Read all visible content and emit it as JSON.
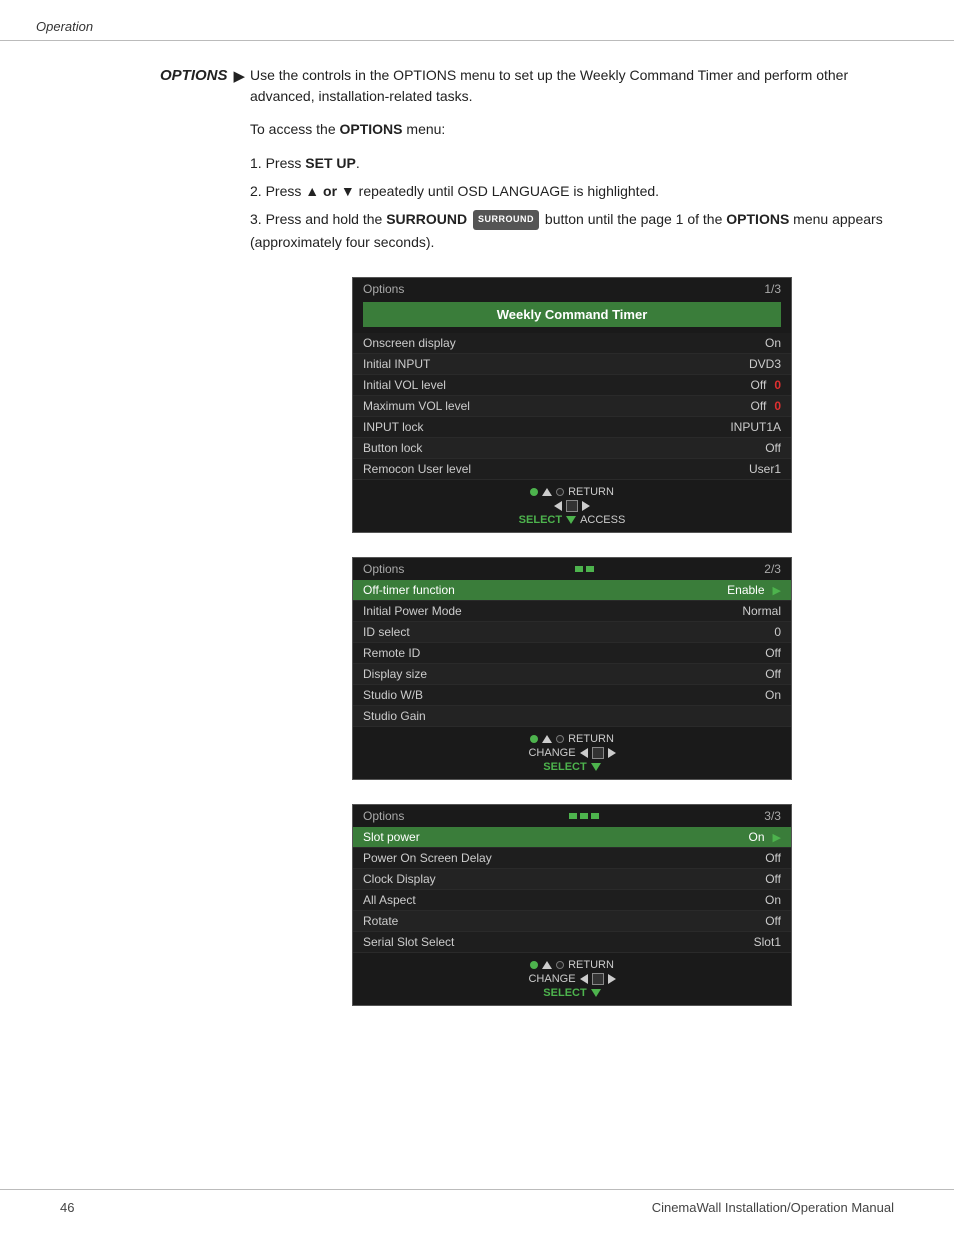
{
  "header": {
    "breadcrumb": "Operation"
  },
  "section": {
    "label": "OPTIONS",
    "arrow": "▶",
    "description": "Use the controls in the OPTIONS menu to set up the Weekly Command Timer and perform other advanced, installation-related tasks.",
    "access_intro": "To access the",
    "access_bold": "OPTIONS",
    "access_suffix": "menu:",
    "steps": [
      {
        "num": "1.",
        "text": "Press ",
        "bold": "SET UP",
        "rest": "."
      },
      {
        "num": "2.",
        "text": "Press ",
        "symbol": "▲ or ▼",
        "rest": " repeatedly until OSD LANGUAGE is highlighted."
      },
      {
        "num": "3.",
        "text": "Press and hold the ",
        "bold": "SURROUND",
        "badge": "SURROUND",
        "mid": " button until the page 1 of the ",
        "bold2": "OPTIONS",
        "end": " menu appears (approximately four seconds)."
      }
    ]
  },
  "panel1": {
    "title_label": "Options",
    "page": "1/3",
    "highlight_row": "Weekly Command Timer",
    "rows": [
      {
        "label": "Onscreen display",
        "value": "On",
        "red": ""
      },
      {
        "label": "Initial INPUT",
        "value": "DVD3",
        "red": ""
      },
      {
        "label": "Initial VOL level",
        "value": "Off",
        "red": "0"
      },
      {
        "label": "Maximum VOL level",
        "value": "Off",
        "red": "0"
      },
      {
        "label": "INPUT lock",
        "value": "INPUT1A",
        "red": ""
      },
      {
        "label": "Button lock",
        "value": "Off",
        "red": ""
      },
      {
        "label": "Remocon User level",
        "value": "User1",
        "red": ""
      }
    ],
    "nav": {
      "line1": {
        "dot1": "green",
        "triangle": "up",
        "dot2": "black",
        "label": "RETURN"
      },
      "line2": {
        "left": true,
        "square": true,
        "right": true
      },
      "line3": {
        "label_green": "SELECT",
        "triangle_down": true,
        "label_white": "ACCESS"
      }
    }
  },
  "panel2": {
    "title_label": "Options",
    "page": "2/3",
    "dots": [
      false,
      true,
      false
    ],
    "highlight_row": "Off-timer function",
    "highlight_value": "Enable",
    "rows": [
      {
        "label": "Initial Power Mode",
        "value": "Normal",
        "red": ""
      },
      {
        "label": "ID select",
        "value": "0",
        "red": ""
      },
      {
        "label": "Remote ID",
        "value": "Off",
        "red": ""
      },
      {
        "label": "Display size",
        "value": "Off",
        "red": ""
      },
      {
        "label": "Studio W/B",
        "value": "On",
        "red": ""
      },
      {
        "label": "Studio Gain",
        "value": "",
        "red": ""
      }
    ],
    "nav": {
      "line1": {
        "dot1": "green",
        "triangle": "up",
        "dot2": "black",
        "label": "RETURN"
      },
      "line2_label": "CHANGE",
      "line2": {
        "left": true,
        "square": true,
        "right": true
      },
      "line3_label_green": "SELECT",
      "line3_triangle": "down"
    }
  },
  "panel3": {
    "title_label": "Options",
    "page": "3/3",
    "dots": [
      false,
      false,
      true
    ],
    "highlight_row": "Slot power",
    "highlight_value": "On",
    "rows": [
      {
        "label": "Power On Screen Delay",
        "value": "Off",
        "red": ""
      },
      {
        "label": "Clock Display",
        "value": "Off",
        "red": ""
      },
      {
        "label": "All Aspect",
        "value": "On",
        "red": ""
      },
      {
        "label": "Rotate",
        "value": "Off",
        "red": ""
      },
      {
        "label": "Serial Slot Select",
        "value": "Slot1",
        "red": ""
      }
    ],
    "nav": {
      "line1": {
        "dot1": "green",
        "triangle": "up",
        "dot2": "black",
        "label": "RETURN"
      },
      "line2_label": "CHANGE",
      "line2": {
        "left": true,
        "square": true,
        "right": true
      },
      "line3_label_green": "SELECT",
      "line3_triangle": "down"
    }
  },
  "footer": {
    "page_number": "46",
    "manual_title": "CinemaWall Installation/Operation Manual"
  }
}
